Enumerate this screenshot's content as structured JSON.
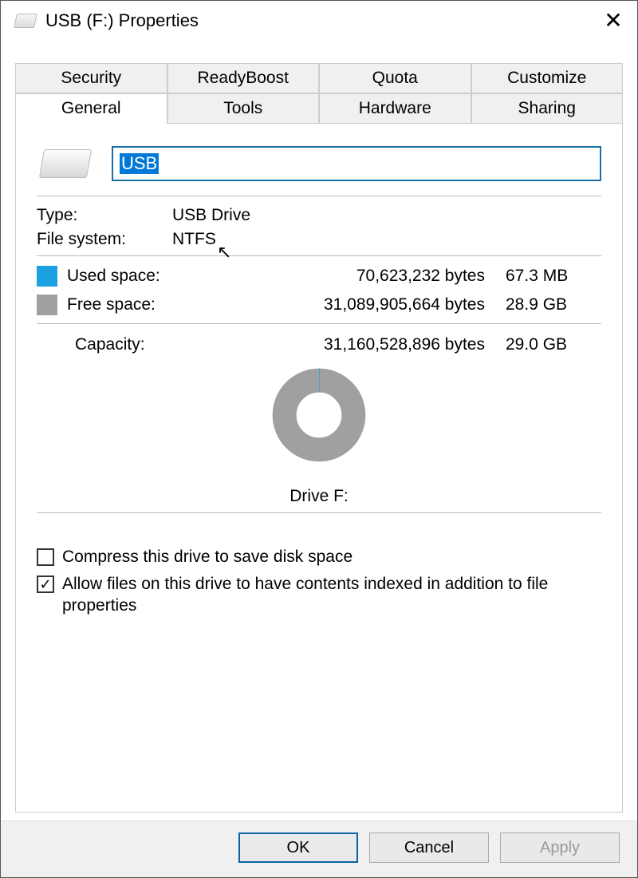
{
  "window": {
    "title": "USB (F:) Properties"
  },
  "tabs": {
    "row1": [
      "Security",
      "ReadyBoost",
      "Quota",
      "Customize"
    ],
    "row2": [
      "General",
      "Tools",
      "Hardware",
      "Sharing"
    ],
    "active": "General"
  },
  "drive": {
    "label_value": "USB",
    "type_label": "Type:",
    "type_value": "USB Drive",
    "fs_label": "File system:",
    "fs_value": "NTFS",
    "used_label": "Used space:",
    "used_bytes": "70,623,232 bytes",
    "used_human": "67.3 MB",
    "free_label": "Free space:",
    "free_bytes": "31,089,905,664 bytes",
    "free_human": "28.9 GB",
    "cap_label": "Capacity:",
    "cap_bytes": "31,160,528,896 bytes",
    "cap_human": "29.0 GB",
    "letter_label": "Drive F:",
    "used_color": "#1ba1e2",
    "free_color": "#a0a0a0"
  },
  "options": {
    "compress_label": "Compress this drive to save disk space",
    "compress_checked": false,
    "index_label": "Allow files on this drive to have contents indexed in addition to file properties",
    "index_checked": true
  },
  "buttons": {
    "ok": "OK",
    "cancel": "Cancel",
    "apply": "Apply"
  },
  "chart_data": {
    "type": "pie",
    "title": "Drive F:",
    "series": [
      {
        "name": "Used space",
        "value": 70623232,
        "color": "#1ba1e2"
      },
      {
        "name": "Free space",
        "value": 31089905664,
        "color": "#a0a0a0"
      }
    ],
    "total": 31160528896
  }
}
